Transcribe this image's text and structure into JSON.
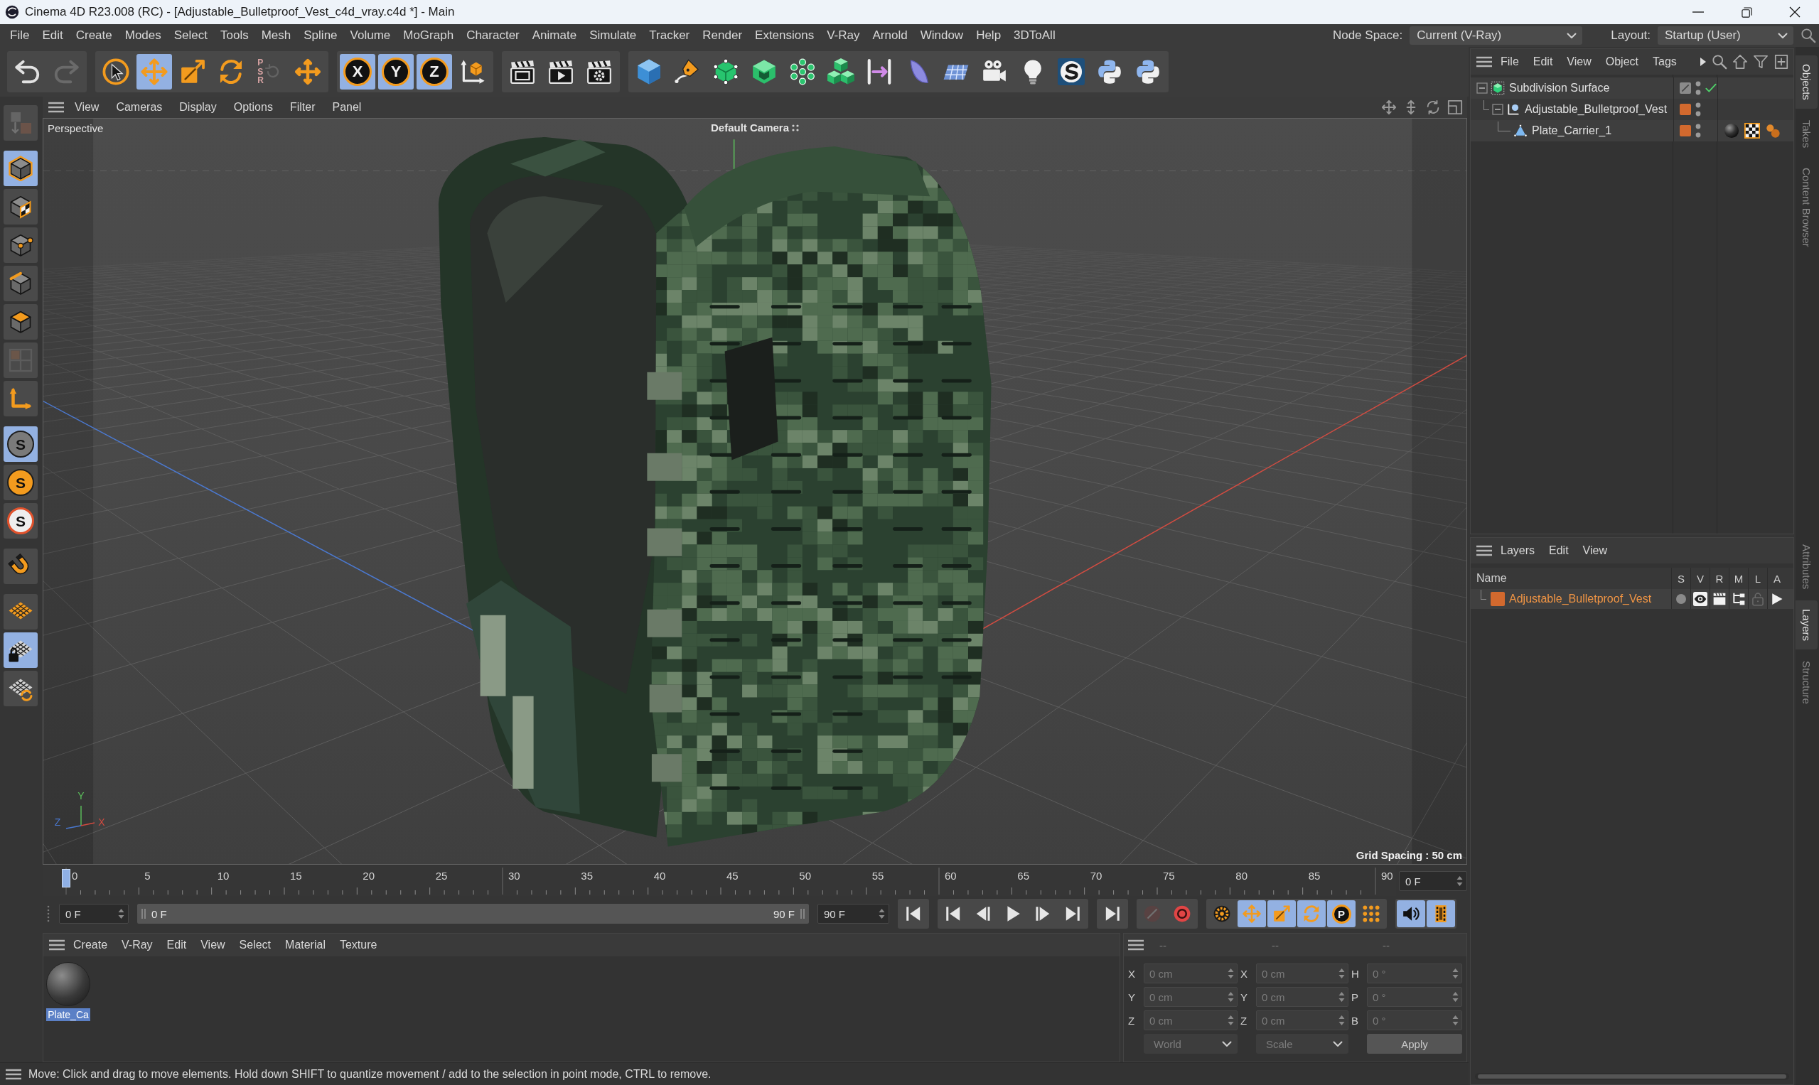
{
  "window": {
    "title": "Cinema 4D R23.008 (RC) - [Adjustable_Bulletproof_Vest_c4d_vray.c4d *] - Main"
  },
  "menu_bar": {
    "items": [
      "File",
      "Edit",
      "Create",
      "Modes",
      "Select",
      "Tools",
      "Mesh",
      "Spline",
      "Volume",
      "MoGraph",
      "Character",
      "Animate",
      "Simulate",
      "Tracker",
      "Render",
      "Extensions",
      "V-Ray",
      "Arnold",
      "Window",
      "Help",
      "3DToAll"
    ],
    "node_space": {
      "label": "Node Space:",
      "value": "Current (V-Ray)"
    },
    "layout": {
      "label": "Layout:",
      "value": "Startup (User)"
    }
  },
  "toolbar": {
    "groups": [
      {
        "tools": [
          {
            "selected": false,
            "disabled": false
          },
          {
            "selected": false,
            "disabled": true
          }
        ]
      },
      {
        "tools": [
          {
            "selected": false,
            "disabled": false
          },
          {
            "selected": true,
            "disabled": false
          },
          {
            "selected": false,
            "disabled": false
          },
          {
            "selected": false,
            "disabled": false
          },
          {
            "label": "PSR",
            "selected": false,
            "disabled": true
          },
          {
            "selected": false,
            "disabled": false
          }
        ]
      },
      {
        "tools": [
          {
            "label": "X",
            "selected": true,
            "disabled": false
          },
          {
            "label": "Y",
            "selected": true,
            "disabled": false
          },
          {
            "label": "Z",
            "selected": true,
            "disabled": false
          },
          {
            "selected": false,
            "disabled": false
          }
        ]
      },
      {
        "tools": [
          {
            "selected": false,
            "disabled": false
          },
          {
            "selected": false,
            "disabled": false
          },
          {
            "selected": false,
            "disabled": false
          }
        ]
      },
      {
        "tools": [
          {
            "selected": false,
            "disabled": false
          },
          {
            "selected": false,
            "disabled": false
          },
          {
            "selected": false,
            "disabled": false
          },
          {
            "selected": false,
            "disabled": false
          },
          {
            "selected": false,
            "disabled": false
          },
          {
            "selected": false,
            "disabled": false
          },
          {
            "selected": false,
            "disabled": false
          },
          {
            "selected": false,
            "disabled": false
          },
          {
            "selected": false,
            "disabled": false
          },
          {
            "selected": false,
            "disabled": false
          },
          {
            "selected": false,
            "disabled": false
          },
          {
            "selected": false,
            "disabled": false
          },
          {
            "selected": false,
            "disabled": false
          },
          {
            "selected": false,
            "disabled": false
          }
        ]
      }
    ]
  },
  "mode_toolbar": {
    "groups": [
      {
        "tools": [
          {
            "selected": false,
            "disabled": true
          }
        ]
      },
      {
        "tools": [
          {
            "selected": true,
            "disabled": false
          },
          {
            "selected": false,
            "disabled": false
          },
          {
            "selected": false,
            "disabled": false
          },
          {
            "selected": false,
            "disabled": false
          },
          {
            "selected": false,
            "disabled": false
          },
          {
            "selected": false,
            "disabled": true
          },
          {
            "selected": false,
            "disabled": false
          }
        ]
      },
      {
        "tools": [
          {
            "label": "S",
            "selected": true,
            "disabled": false
          },
          {
            "label": "S",
            "selected": false,
            "disabled": false
          },
          {
            "label": "S",
            "selected": false,
            "disabled": false
          }
        ]
      },
      {
        "tools": [
          {
            "selected": false,
            "disabled": false
          }
        ]
      },
      {
        "tools": [
          {
            "selected": false,
            "disabled": false
          },
          {
            "selected": true,
            "disabled": false
          },
          {
            "selected": false,
            "disabled": false
          }
        ]
      }
    ]
  },
  "viewport": {
    "menu": [
      "View",
      "Cameras",
      "Display",
      "Options",
      "Filter",
      "Panel"
    ],
    "camera_mode": "Perspective",
    "camera_name": "Default Camera",
    "grid_spacing": "Grid Spacing : 50 cm",
    "axes": [
      {
        "label": "Y",
        "color": "#5cc25c"
      },
      {
        "label": "Z",
        "color": "#4a78d0"
      },
      {
        "label": "X",
        "color": "#d24b40"
      }
    ]
  },
  "timeline": {
    "ticks": [
      "0",
      "5",
      "10",
      "15",
      "20",
      "25",
      "30",
      "35",
      "40",
      "45",
      "50",
      "55",
      "60",
      "65",
      "70",
      "75",
      "80",
      "85",
      "90"
    ],
    "playhead": {
      "level": 0
    },
    "current_frame": "0 F"
  },
  "transport": {
    "start_frame": "0 F",
    "range": {
      "start": "0 F",
      "end": "90 F",
      "level": 1
    },
    "end_frame": "90 F",
    "groups": [
      {
        "buttons": [
          {
            "selected": false,
            "disabled": false
          }
        ]
      },
      {
        "buttons": [
          {
            "selected": false,
            "disabled": false
          },
          {
            "selected": false,
            "disabled": false
          },
          {
            "selected": false,
            "disabled": false
          },
          {
            "selected": false,
            "disabled": false
          },
          {
            "selected": false,
            "disabled": false
          }
        ]
      },
      {
        "buttons": [
          {
            "selected": false,
            "disabled": false
          }
        ]
      },
      {
        "buttons": [
          {
            "selected": false,
            "disabled": true
          },
          {
            "selected": false,
            "disabled": false
          }
        ]
      },
      {
        "buttons": [
          {
            "selected": false,
            "disabled": false
          },
          {
            "selected": true,
            "disabled": false
          },
          {
            "selected": true,
            "disabled": false
          },
          {
            "selected": true,
            "disabled": false
          },
          {
            "label": "P",
            "selected": true,
            "disabled": false
          },
          {
            "selected": false,
            "disabled": false
          }
        ]
      },
      {
        "buttons": [
          {
            "selected": true,
            "disabled": false
          },
          {
            "selected": true,
            "disabled": false
          }
        ]
      }
    ]
  },
  "material_manager": {
    "menu": [
      "Create",
      "V-Ray",
      "Edit",
      "View",
      "Select",
      "Material",
      "Texture"
    ],
    "materials": [
      {
        "name": "Plate_Ca",
        "selected": true
      }
    ]
  },
  "coordinates": {
    "headers": [
      "--",
      "--",
      "--"
    ],
    "disabled": true,
    "rows": [
      {
        "position_axis": "X",
        "position": "0 cm",
        "size_axis": "X",
        "size": "0 cm",
        "rotation_axis": "H",
        "rotation": "0 °"
      },
      {
        "position_axis": "Y",
        "position": "0 cm",
        "size_axis": "Y",
        "size": "0 cm",
        "rotation_axis": "P",
        "rotation": "0 °"
      },
      {
        "position_axis": "Z",
        "position": "0 cm",
        "size_axis": "Z",
        "size": "0 cm",
        "rotation_axis": "B",
        "rotation": "0 °"
      }
    ],
    "position_mode": "World",
    "size_mode": "Scale",
    "apply_button": "Apply"
  },
  "status_bar": {
    "text": "Move: Click and drag to move elements. Hold down SHIFT to quantize movement / add to the selection in point mode, CTRL to remove."
  },
  "object_manager": {
    "menu": [
      "File",
      "Edit",
      "View",
      "Object",
      "Tags"
    ],
    "objects": [
      {
        "name": "Subdivision Surface",
        "kind": "subdivision",
        "selected": false,
        "expanded": true,
        "enabled": true,
        "children": [
          {
            "name": "Adjustable_Bulletproof_Vest",
            "kind": "null",
            "color": "#d2692e",
            "selected": false,
            "expanded": true,
            "children": [
              {
                "name": "Plate_Carrier_1",
                "kind": "polygon",
                "color": "#d2692e",
                "selected": false,
                "tags": [
                  {
                    "kind": "material"
                  },
                  {
                    "kind": "uvw"
                  },
                  {
                    "kind": "vray"
                  }
                ]
              }
            ]
          }
        ]
      }
    ]
  },
  "layer_manager": {
    "menu": [
      "Layers",
      "Edit",
      "View"
    ],
    "columns": [
      "Name",
      "S",
      "V",
      "R",
      "M",
      "L",
      "A"
    ],
    "layers": [
      {
        "name": "Adjustable_Bulletproof_Vest",
        "color": "#d2692e",
        "solo": false,
        "visible": true,
        "render": true,
        "manager": true,
        "locked": false,
        "animation": true
      }
    ]
  },
  "side_tabs": {
    "top": [
      {
        "label": "Objects",
        "selected": true
      },
      {
        "label": "Takes",
        "selected": false
      },
      {
        "label": "Content Browser",
        "selected": false
      }
    ],
    "bottom": [
      {
        "label": "Attributes",
        "selected": false
      },
      {
        "label": "Layers",
        "selected": true
      },
      {
        "label": "Structure",
        "selected": false
      }
    ]
  }
}
